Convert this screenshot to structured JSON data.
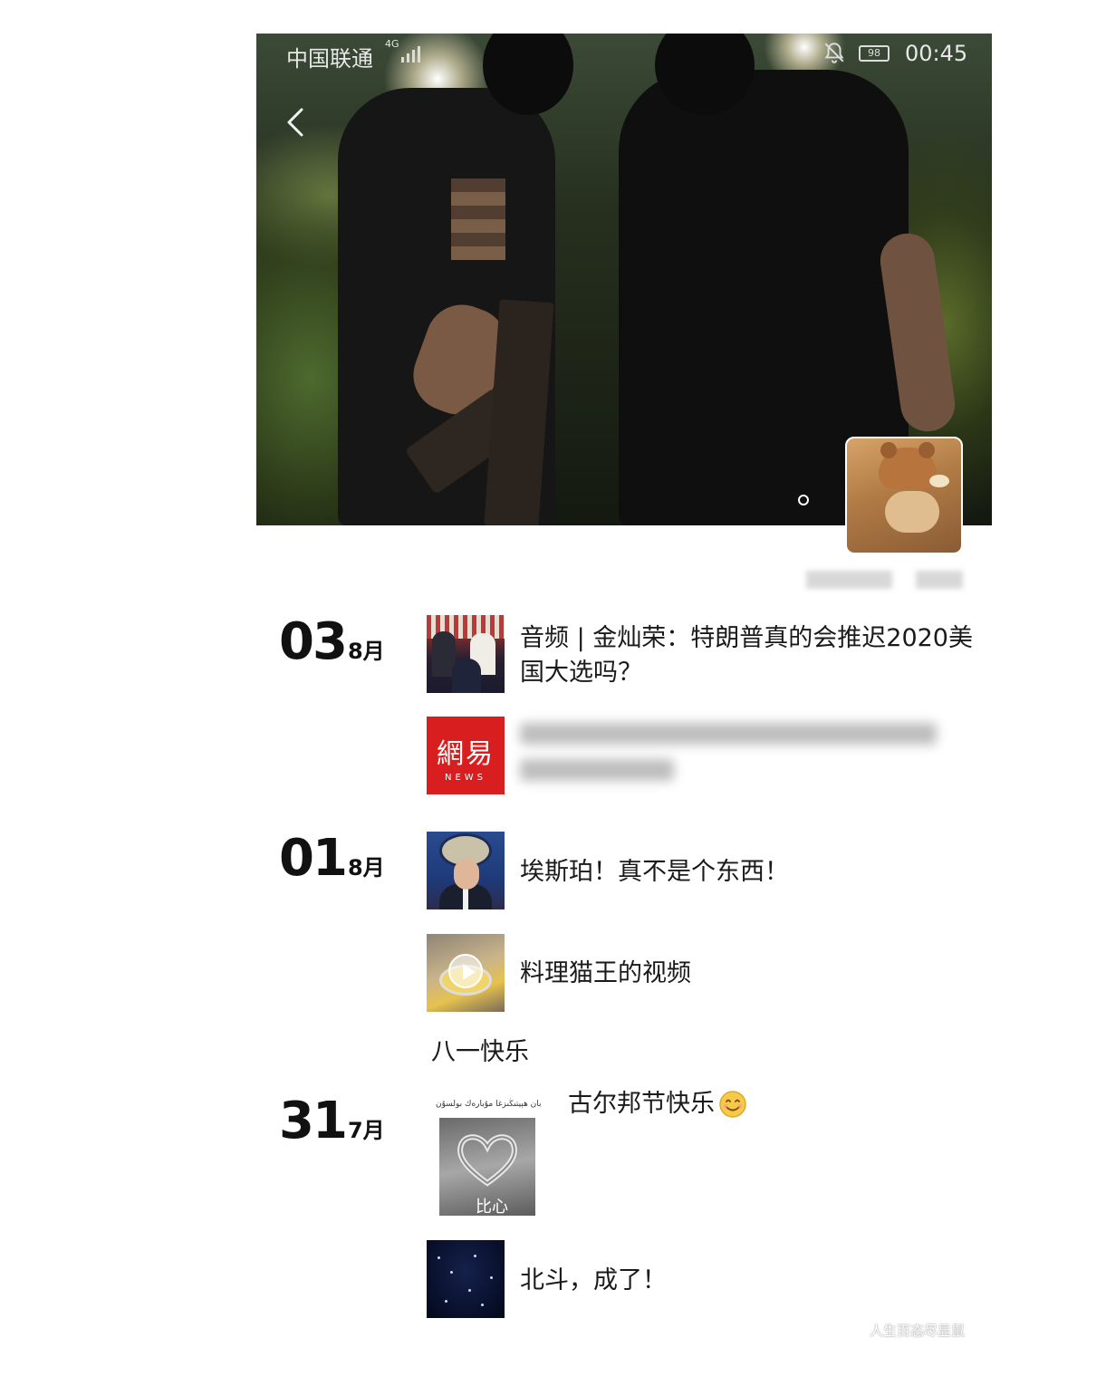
{
  "status_bar": {
    "carrier": "中国联通",
    "network": "4G",
    "time": "00:45",
    "battery": "98"
  },
  "cover": {
    "image": "night-photo-two-armed-men",
    "pager": "1 of 1"
  },
  "avatar": {
    "image": "rilakkuma-hat-cat"
  },
  "icons": {
    "back": "chevron-left-icon",
    "mute": "bell-off-icon",
    "play": "play-icon",
    "smile": "smile-emoji"
  },
  "timeline": {
    "groups": [
      {
        "day": "03",
        "month": "8月",
        "posts": [
          {
            "thumb": "trump-speech",
            "text": "音频 | 金灿荣：特朗普真的会推迟2020美国大选吗？"
          },
          {
            "thumb": "netease-news-logo",
            "logo": "網易",
            "logo_sub": "NEWS",
            "text_blurred": true
          }
        ]
      },
      {
        "day": "01",
        "month": "8月",
        "posts": [
          {
            "thumb": "esper-portrait",
            "text": "埃斯珀！真不是个东西！"
          },
          {
            "thumb": "food-video",
            "text": "料理猫王的视频"
          },
          {
            "thumb": "",
            "text": "八一快乐"
          }
        ]
      },
      {
        "day": "31",
        "month": "7月",
        "posts": [
          {
            "thumb": "handcuff-heart",
            "caption_top": "قۇربان ھېيتىڭىزغا مۇبارەك بولسۇن",
            "caption_bottom": "比心",
            "text": "古尔邦节快乐"
          },
          {
            "thumb": "starry-sky",
            "text": "北斗，成了！"
          }
        ]
      }
    ]
  },
  "watermark": "人生百态尽显鼠"
}
